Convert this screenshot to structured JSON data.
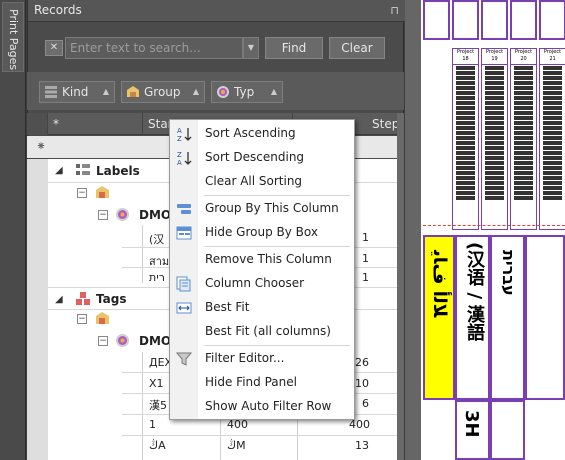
{
  "side_tab": {
    "label": "Print Pages"
  },
  "panel": {
    "title": "Records",
    "pin_glyph": "⊓"
  },
  "search": {
    "placeholder": "Enter text to search...",
    "clear_glyph": "✕",
    "dropdown_glyph": "▼"
  },
  "buttons": {
    "find": "Find",
    "clear": "Clear"
  },
  "chips": [
    {
      "label": "Kind",
      "arrow": "▲"
    },
    {
      "label": "Group",
      "arrow": "▲"
    },
    {
      "label": "Typ",
      "arrow": "▲"
    }
  ],
  "grid": {
    "columns": [
      "*",
      "Star",
      "Step"
    ],
    "filter_glyph": "⁕",
    "groups": [
      {
        "label": "Labels",
        "subgroup": "DMO-",
        "rows": [
          {
            "text": "(汉",
            "value": "1"
          },
          {
            "text": "สาม",
            "value": "1"
          },
          {
            "text": "רית",
            "value": "1"
          }
        ]
      },
      {
        "label": "Tags",
        "subgroup": "DMO-",
        "rows": [
          {
            "text": "ДЕХ",
            "value": "26"
          },
          {
            "text": "X1",
            "value": "10"
          },
          {
            "text": "漢5",
            "value": "6"
          },
          {
            "text": "1",
            "mid": "400",
            "value": "400"
          },
          {
            "text": "ڭA",
            "mid": "ڭM",
            "value": "13"
          }
        ]
      }
    ]
  },
  "context_menu": {
    "items": [
      {
        "label": "Sort Ascending",
        "icon": "sort-ascending-icon"
      },
      {
        "label": "Sort Descending",
        "icon": "sort-descending-icon"
      },
      {
        "label": "Clear All Sorting",
        "icon": ""
      },
      {
        "label": "Group By This Column",
        "icon": "group-by-column-icon"
      },
      {
        "label": "Hide Group By Box",
        "icon": "group-by-box-icon"
      },
      {
        "label": "Remove This Column",
        "icon": ""
      },
      {
        "label": "Column Chooser",
        "icon": "column-chooser-icon"
      },
      {
        "label": "Best Fit",
        "icon": "best-fit-icon"
      },
      {
        "label": "Best Fit (all columns)",
        "icon": ""
      },
      {
        "label": "Filter Editor...",
        "icon": "filter-icon"
      },
      {
        "label": "Hide Find Panel",
        "icon": ""
      },
      {
        "label": "Show Auto Filter Row",
        "icon": ""
      }
    ]
  },
  "preview": {
    "header_label": "Project",
    "col_numbers": [
      "18",
      "19",
      "20",
      "21"
    ],
    "big_text": [
      "ﻼﻟﺃ ﻑﺎﻳ",
      "(汉语 / 漢語",
      "עברית"
    ],
    "bottom_text": "3H"
  },
  "colors": {
    "accent_purple": "#7b3fb5",
    "highlight_yellow": "#ffff00",
    "red_box": "#e04040"
  }
}
